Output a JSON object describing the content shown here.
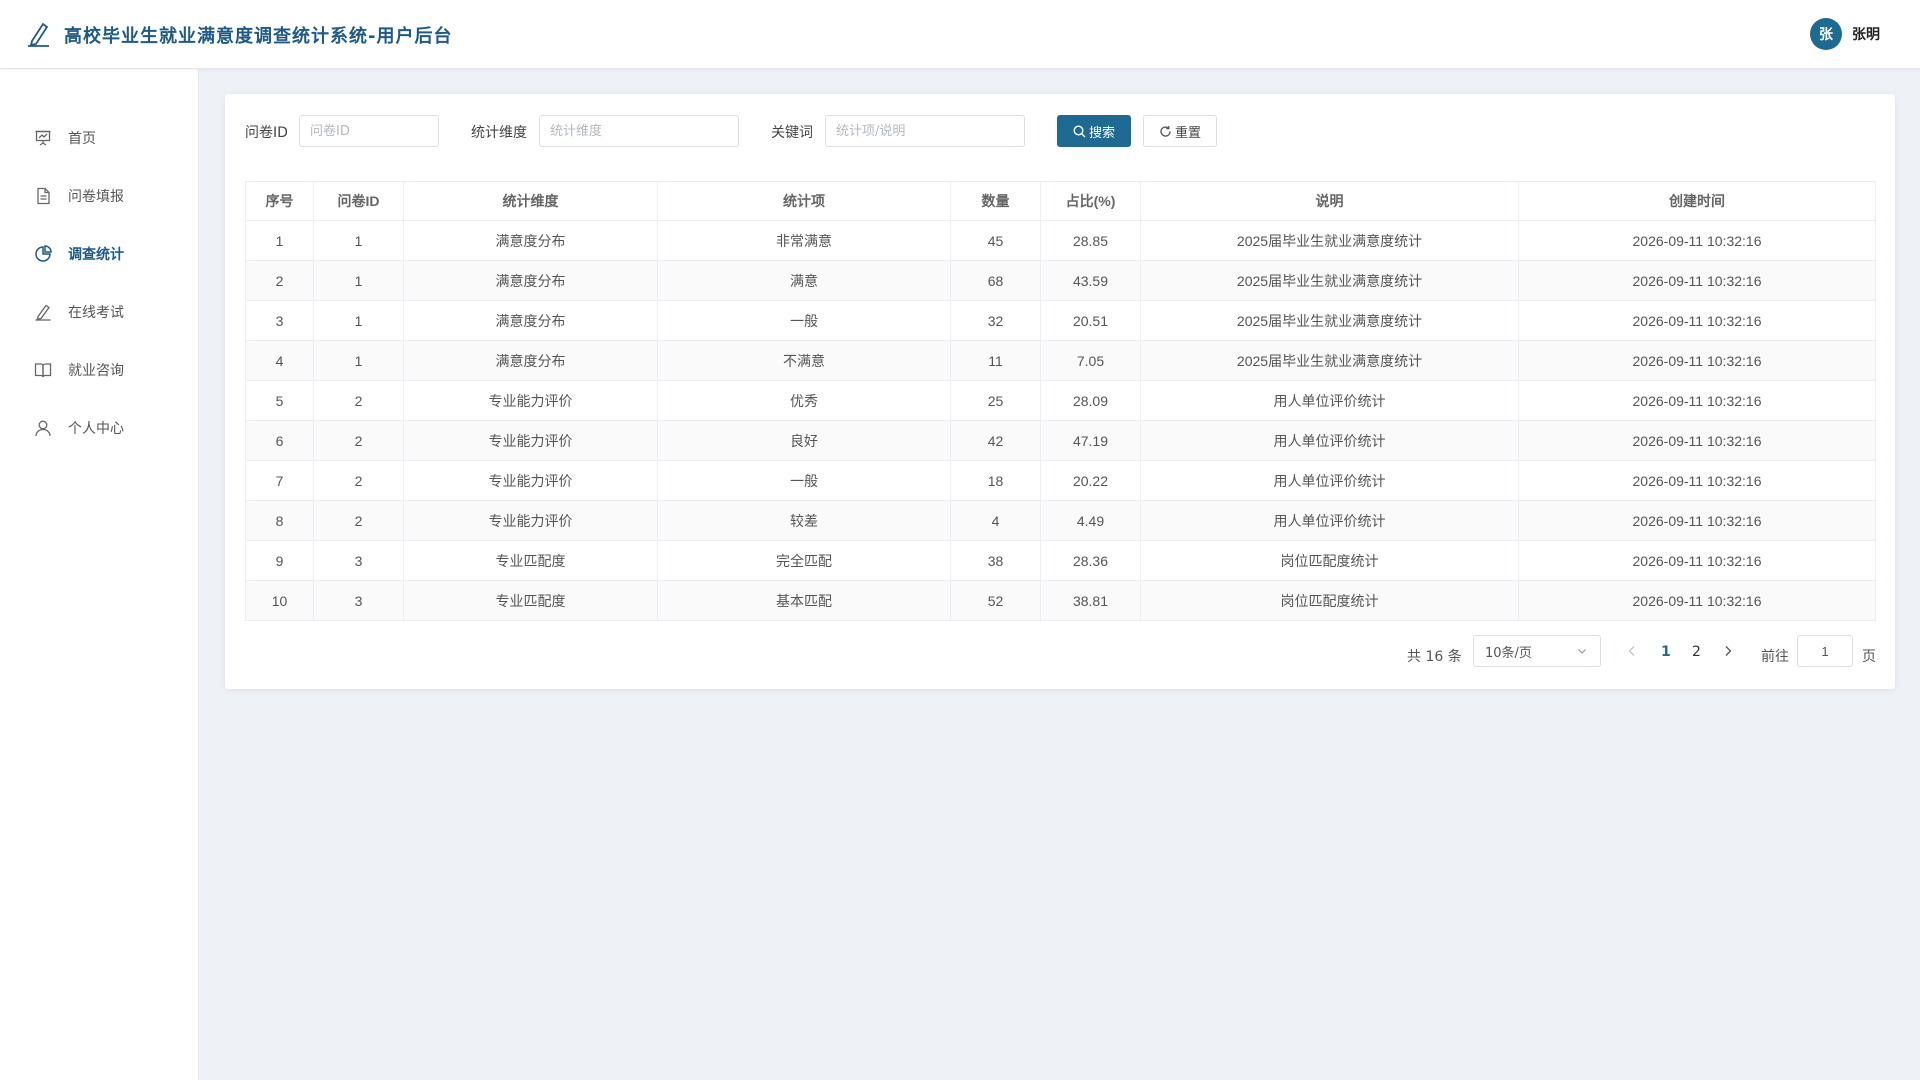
{
  "header": {
    "app_title": "高校毕业生就业满意度调查统计系统-用户后台",
    "user": {
      "avatar_char": "张",
      "name": "张明"
    }
  },
  "sidebar": {
    "items": [
      {
        "label": "首页",
        "icon": "presentation-icon",
        "active": false
      },
      {
        "label": "问卷填报",
        "icon": "document-icon",
        "active": false
      },
      {
        "label": "调查统计",
        "icon": "pie-chart-icon",
        "active": true
      },
      {
        "label": "在线考试",
        "icon": "edit-pen-icon",
        "active": false
      },
      {
        "label": "就业咨询",
        "icon": "open-book-icon",
        "active": false
      },
      {
        "label": "个人中心",
        "icon": "user-icon",
        "active": false
      }
    ]
  },
  "filters": {
    "questionnaire_id": {
      "label": "问卷ID",
      "placeholder": "问卷ID",
      "value": ""
    },
    "dimension": {
      "label": "统计维度",
      "placeholder": "统计维度",
      "value": ""
    },
    "keyword": {
      "label": "关键词",
      "placeholder": "统计项/说明",
      "value": ""
    },
    "search_label": "搜索",
    "reset_label": "重置"
  },
  "table": {
    "columns": [
      "序号",
      "问卷ID",
      "统计维度",
      "统计项",
      "数量",
      "占比(%)",
      "说明",
      "创建时间"
    ],
    "rows": [
      [
        "1",
        "1",
        "满意度分布",
        "非常满意",
        "45",
        "28.85",
        "2025届毕业生就业满意度统计",
        "2026-09-11 10:32:16"
      ],
      [
        "2",
        "1",
        "满意度分布",
        "满意",
        "68",
        "43.59",
        "2025届毕业生就业满意度统计",
        "2026-09-11 10:32:16"
      ],
      [
        "3",
        "1",
        "满意度分布",
        "一般",
        "32",
        "20.51",
        "2025届毕业生就业满意度统计",
        "2026-09-11 10:32:16"
      ],
      [
        "4",
        "1",
        "满意度分布",
        "不满意",
        "11",
        "7.05",
        "2025届毕业生就业满意度统计",
        "2026-09-11 10:32:16"
      ],
      [
        "5",
        "2",
        "专业能力评价",
        "优秀",
        "25",
        "28.09",
        "用人单位评价统计",
        "2026-09-11 10:32:16"
      ],
      [
        "6",
        "2",
        "专业能力评价",
        "良好",
        "42",
        "47.19",
        "用人单位评价统计",
        "2026-09-11 10:32:16"
      ],
      [
        "7",
        "2",
        "专业能力评价",
        "一般",
        "18",
        "20.22",
        "用人单位评价统计",
        "2026-09-11 10:32:16"
      ],
      [
        "8",
        "2",
        "专业能力评价",
        "较差",
        "4",
        "4.49",
        "用人单位评价统计",
        "2026-09-11 10:32:16"
      ],
      [
        "9",
        "3",
        "专业匹配度",
        "完全匹配",
        "38",
        "28.36",
        "岗位匹配度统计",
        "2026-09-11 10:32:16"
      ],
      [
        "10",
        "3",
        "专业匹配度",
        "基本匹配",
        "52",
        "38.81",
        "岗位匹配度统计",
        "2026-09-11 10:32:16"
      ]
    ]
  },
  "pagination": {
    "total_text": "共 16 条",
    "page_size": "10条/页",
    "pages": [
      "1",
      "2"
    ],
    "current_page": "1",
    "goto_label": "前往",
    "goto_value": "1",
    "page_suffix": "页"
  },
  "colors": {
    "brand": "#1e5a85",
    "button_primary": "#1e6a92"
  }
}
